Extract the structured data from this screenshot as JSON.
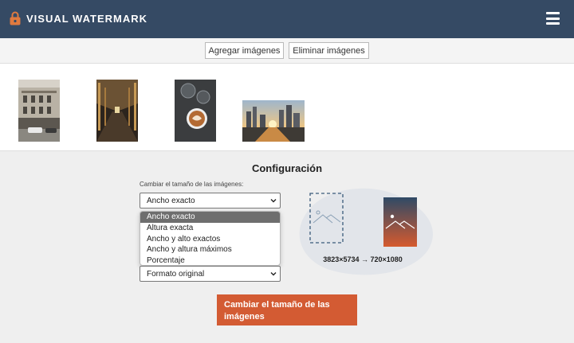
{
  "header": {
    "brand": "VISUAL WATERMARK",
    "logo_icon": "padlock-icon",
    "menu_icon": "hamburger-menu-icon"
  },
  "toolbar": {
    "add_images": "Agregar imágenes",
    "remove_images": "Eliminar imágenes"
  },
  "thumbnails": [
    {
      "description": "building-facade"
    },
    {
      "description": "train-station-hall"
    },
    {
      "description": "coffee-latte"
    },
    {
      "description": "city-sunset"
    }
  ],
  "config": {
    "title": "Configuración",
    "resize_label": "Cambiar el tamaño de las imágenes:",
    "resize_value": "Ancho exacto",
    "resize_options": [
      "Ancho exacto",
      "Altura exacta",
      "Ancho y alto exactos",
      "Ancho y altura máximos",
      "Porcentaje"
    ],
    "format_value": "Formato original",
    "dimensions": "3823×5734 → 720×1080",
    "resize_button": "Cambiar el tamaño de las imágenes"
  },
  "colors": {
    "header_bg": "#354a64",
    "accent": "#d35b33"
  }
}
